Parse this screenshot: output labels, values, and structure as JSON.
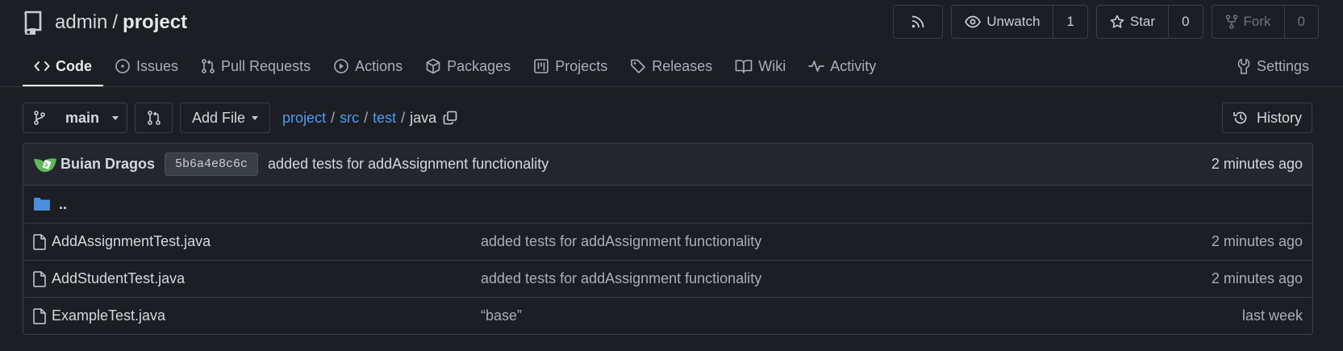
{
  "repo": {
    "owner": "admin",
    "separator": "/",
    "name": "project"
  },
  "header_actions": {
    "watch_label": "Unwatch",
    "watch_count": "1",
    "star_label": "Star",
    "star_count": "0",
    "fork_label": "Fork",
    "fork_count": "0"
  },
  "tabs": [
    {
      "label": "Code",
      "icon": "code-icon"
    },
    {
      "label": "Issues",
      "icon": "issue-icon"
    },
    {
      "label": "Pull Requests",
      "icon": "pull-request-icon"
    },
    {
      "label": "Actions",
      "icon": "play-icon"
    },
    {
      "label": "Packages",
      "icon": "package-icon"
    },
    {
      "label": "Projects",
      "icon": "project-icon"
    },
    {
      "label": "Releases",
      "icon": "tag-icon"
    },
    {
      "label": "Wiki",
      "icon": "book-icon"
    },
    {
      "label": "Activity",
      "icon": "pulse-icon"
    },
    {
      "label": "Settings",
      "icon": "wrench-icon"
    }
  ],
  "toolbar": {
    "branch": "main",
    "add_file": "Add File",
    "history": "History"
  },
  "breadcrumb": {
    "segments": [
      "project",
      "src",
      "test"
    ],
    "current": "java"
  },
  "latest_commit": {
    "author": "Buian Dragos",
    "sha": "5b6a4e8c6c",
    "message": "added tests for addAssignment functionality",
    "age": "2 minutes ago"
  },
  "parent_dir": "..",
  "files": [
    {
      "name": "AddAssignmentTest.java",
      "message": "added tests for addAssignment functionality",
      "age": "2 minutes ago"
    },
    {
      "name": "AddStudentTest.java",
      "message": "added tests for addAssignment functionality",
      "age": "2 minutes ago"
    },
    {
      "name": "ExampleTest.java",
      "message": "“base”",
      "age": "last week"
    }
  ],
  "colors": {
    "background": "#1c1e23",
    "link": "#4f9cf0",
    "folder": "#4a8fdc",
    "border": "#3b3f46"
  }
}
